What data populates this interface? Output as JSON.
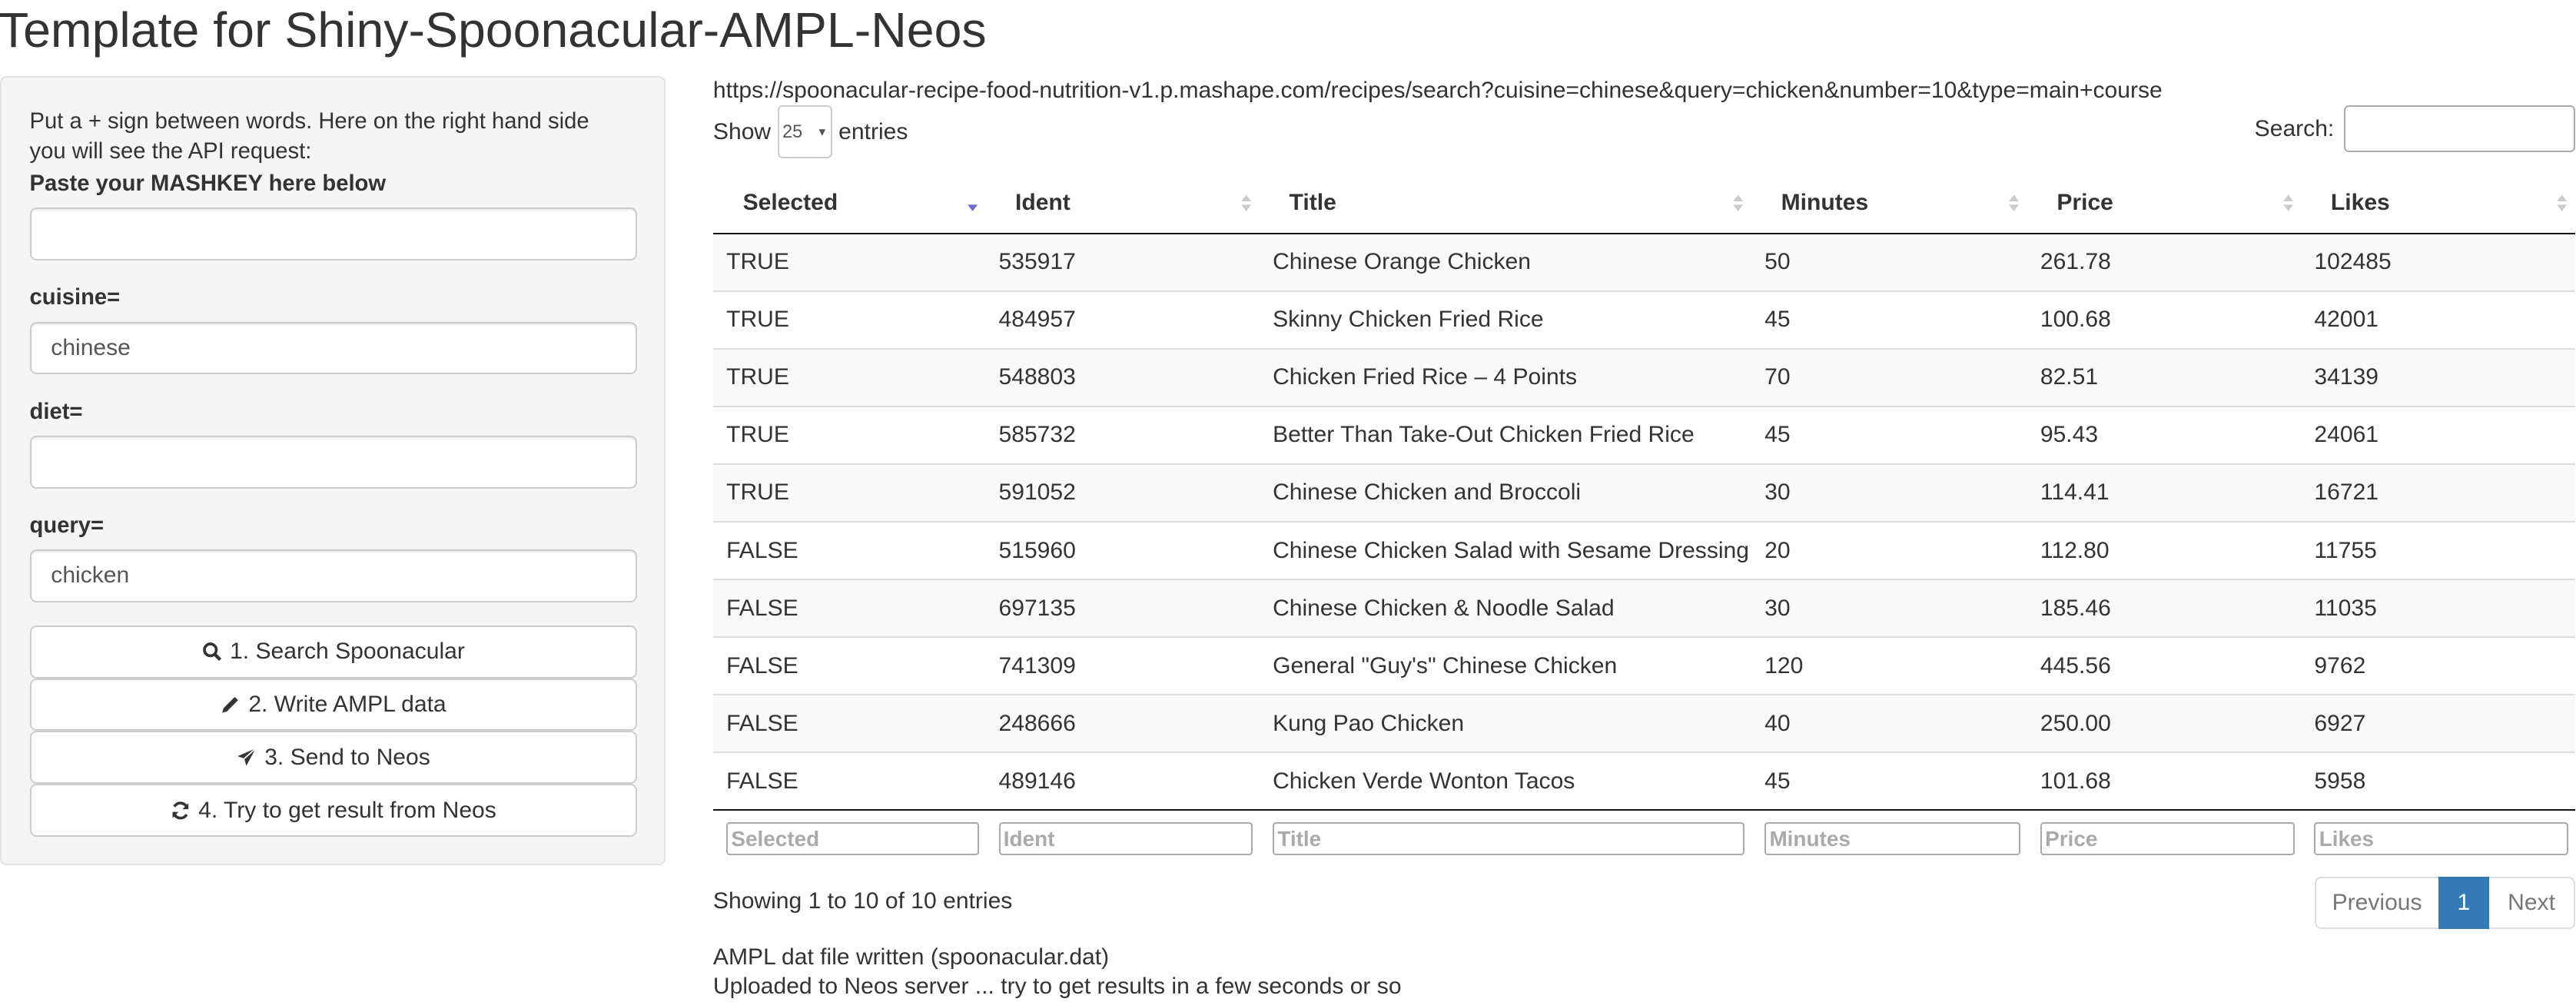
{
  "page_title": "Template for Shiny-Spoonacular-AMPL-Neos",
  "sidebar": {
    "help_text": "Put a + sign between words. Here on the right hand side you will see the API request:",
    "mashkey_label": "Paste your MASHKEY here below",
    "mashkey_value": "",
    "cuisine_label": "cuisine=",
    "cuisine_value": "chinese",
    "diet_label": "diet=",
    "diet_value": "",
    "query_label": "query=",
    "query_value": "chicken",
    "buttons": {
      "search": "1. Search Spoonacular",
      "write": "2. Write AMPL data",
      "send": "3. Send to Neos",
      "result": "4. Try to get result from Neos"
    },
    "icons": [
      "search-icon",
      "pencil-icon",
      "send-icon",
      "refresh-icon"
    ]
  },
  "api_url": "https://spoonacular-recipe-food-nutrition-v1.p.mashape.com/recipes/search?cuisine=chinese&query=chicken&number=10&type=main+course",
  "table": {
    "show_label": "Show",
    "entries_label": "entries",
    "page_length": "25",
    "search_label": "Search:",
    "search_value": "",
    "columns": [
      "Selected",
      "Ident",
      "Title",
      "Minutes",
      "Price",
      "Likes"
    ],
    "sorted_column": "Selected",
    "rows": [
      [
        "TRUE",
        "535917",
        "Chinese Orange Chicken",
        "50",
        "261.78",
        "102485"
      ],
      [
        "TRUE",
        "484957",
        "Skinny Chicken Fried Rice",
        "45",
        "100.68",
        "42001"
      ],
      [
        "TRUE",
        "548803",
        "Chicken Fried Rice – 4 Points",
        "70",
        "82.51",
        "34139"
      ],
      [
        "TRUE",
        "585732",
        "Better Than Take-Out Chicken Fried Rice",
        "45",
        "95.43",
        "24061"
      ],
      [
        "TRUE",
        "591052",
        "Chinese Chicken and Broccoli",
        "30",
        "114.41",
        "16721"
      ],
      [
        "FALSE",
        "515960",
        "Chinese Chicken Salad with Sesame Dressing",
        "20",
        "112.80",
        "11755"
      ],
      [
        "FALSE",
        "697135",
        "Chinese Chicken & Noodle Salad",
        "30",
        "185.46",
        "11035"
      ],
      [
        "FALSE",
        "741309",
        "General \"Guy's\" Chinese Chicken",
        "120",
        "445.56",
        "9762"
      ],
      [
        "FALSE",
        "248666",
        "Kung Pao Chicken",
        "40",
        "250.00",
        "6927"
      ],
      [
        "FALSE",
        "489146",
        "Chicken Verde Wonton Tacos",
        "45",
        "101.68",
        "5958"
      ]
    ],
    "info": "Showing 1 to 10 of 10 entries",
    "pager": {
      "previous": "Previous",
      "current": "1",
      "next": "Next"
    }
  },
  "status": {
    "line1": "AMPL dat file written (spoonacular.dat)",
    "line2": "Uploaded to Neos server ... try to get results in a few seconds or so"
  },
  "colors": {
    "accent": "#337ab7",
    "sidebar_bg": "#f5f5f5",
    "sort_active": "#6b6bd6"
  }
}
